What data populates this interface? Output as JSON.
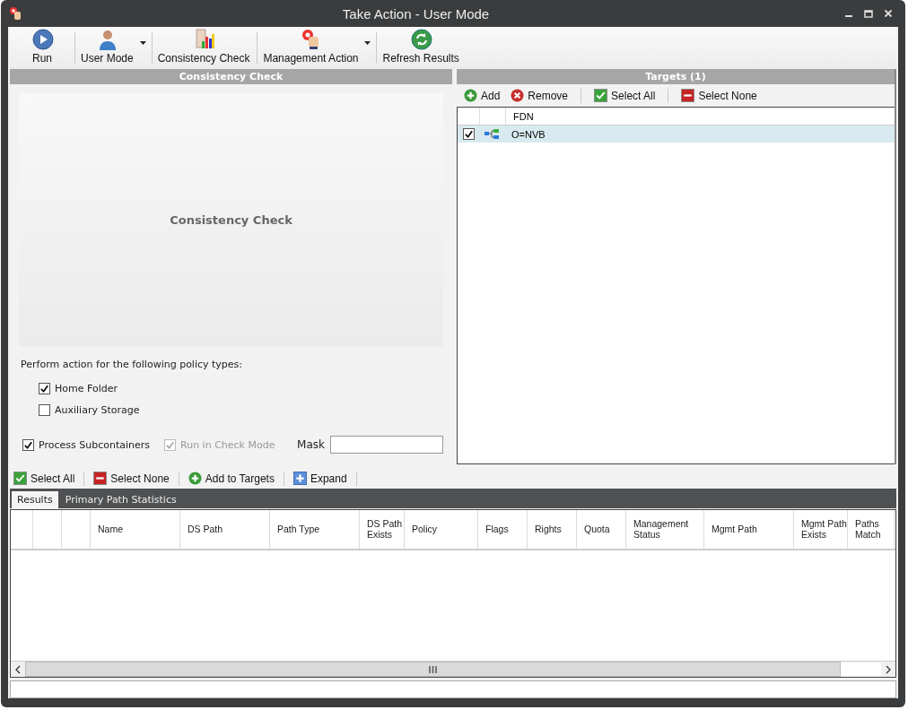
{
  "window": {
    "title": "Take Action - User Mode"
  },
  "toolbar": [
    {
      "kind": "run",
      "label": "Run",
      "dropdown": false
    },
    {
      "kind": "user",
      "label": "User Mode",
      "dropdown": true
    },
    {
      "kind": "chart",
      "label": "Consistency Check",
      "dropdown": false
    },
    {
      "kind": "hand",
      "label": "Management Action",
      "dropdown": true
    },
    {
      "kind": "refresh",
      "label": "Refresh Results",
      "dropdown": false
    }
  ],
  "consistency_panel": {
    "header": "Consistency Check",
    "preview_title": "Consistency Check",
    "policy_prompt": "Perform action for the following policy types:",
    "policy_types": [
      {
        "label": "Home Folder",
        "checked": true
      },
      {
        "label": "Auxiliary Storage",
        "checked": false
      }
    ],
    "options": [
      {
        "label": "Process Subcontainers",
        "checked": true,
        "disabled": false
      },
      {
        "label": "Run in Check Mode",
        "checked": true,
        "disabled": true
      }
    ],
    "mask": {
      "label": "Mask"
    }
  },
  "targets_panel": {
    "header": "Targets  (1)",
    "actions": [
      {
        "kind": "add",
        "label": "Add"
      },
      {
        "kind": "remove",
        "label": "Remove"
      },
      {
        "kind": "select-all",
        "label": "Select All"
      },
      {
        "kind": "select-none",
        "label": "Select None"
      }
    ],
    "column": "FDN",
    "rows": [
      {
        "fdn": "O=NVB",
        "checked": true,
        "selected": true
      }
    ]
  },
  "results_toolbar": [
    {
      "kind": "select-all",
      "label": "Select All"
    },
    {
      "kind": "select-none",
      "label": "Select None"
    },
    {
      "kind": "add",
      "label": "Add to Targets"
    },
    {
      "kind": "expand",
      "label": "Expand"
    }
  ],
  "tabs": [
    {
      "label": "Results",
      "selected": true
    },
    {
      "label": "Primary Path Statistics",
      "selected": false
    }
  ],
  "results_table": {
    "columns": [
      "Name",
      "DS Path",
      "Path Type",
      "DS Path Exists",
      "Policy",
      "Flags",
      "Rights",
      "Quota",
      "Management Status",
      "Mgmt Path",
      "Mgmt Path Exists",
      "Paths Match"
    ]
  }
}
